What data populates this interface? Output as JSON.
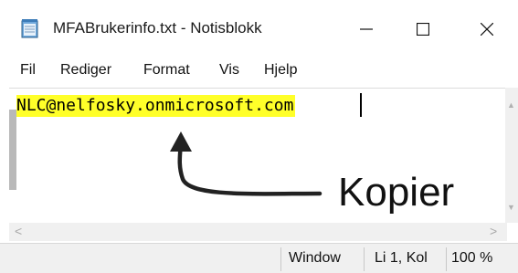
{
  "window": {
    "title": "MFABrukerinfo.txt - Notisblokk",
    "icon": "notepad-icon",
    "controls": [
      "minimize-icon",
      "maximize-icon",
      "close-icon"
    ]
  },
  "menu": {
    "items": [
      "Fil",
      "Rediger",
      "Format",
      "Vis",
      "Hjelp"
    ]
  },
  "editor": {
    "text": "NLC@nelfosky.onmicrosoft.com",
    "highlight_color": "#ffff29"
  },
  "annotation": {
    "label": "Kopier",
    "icon": "curved-arrow-icon"
  },
  "statusbar": {
    "encoding_partial": "Window",
    "position": "Li 1, Kol",
    "zoom": "100 %"
  }
}
